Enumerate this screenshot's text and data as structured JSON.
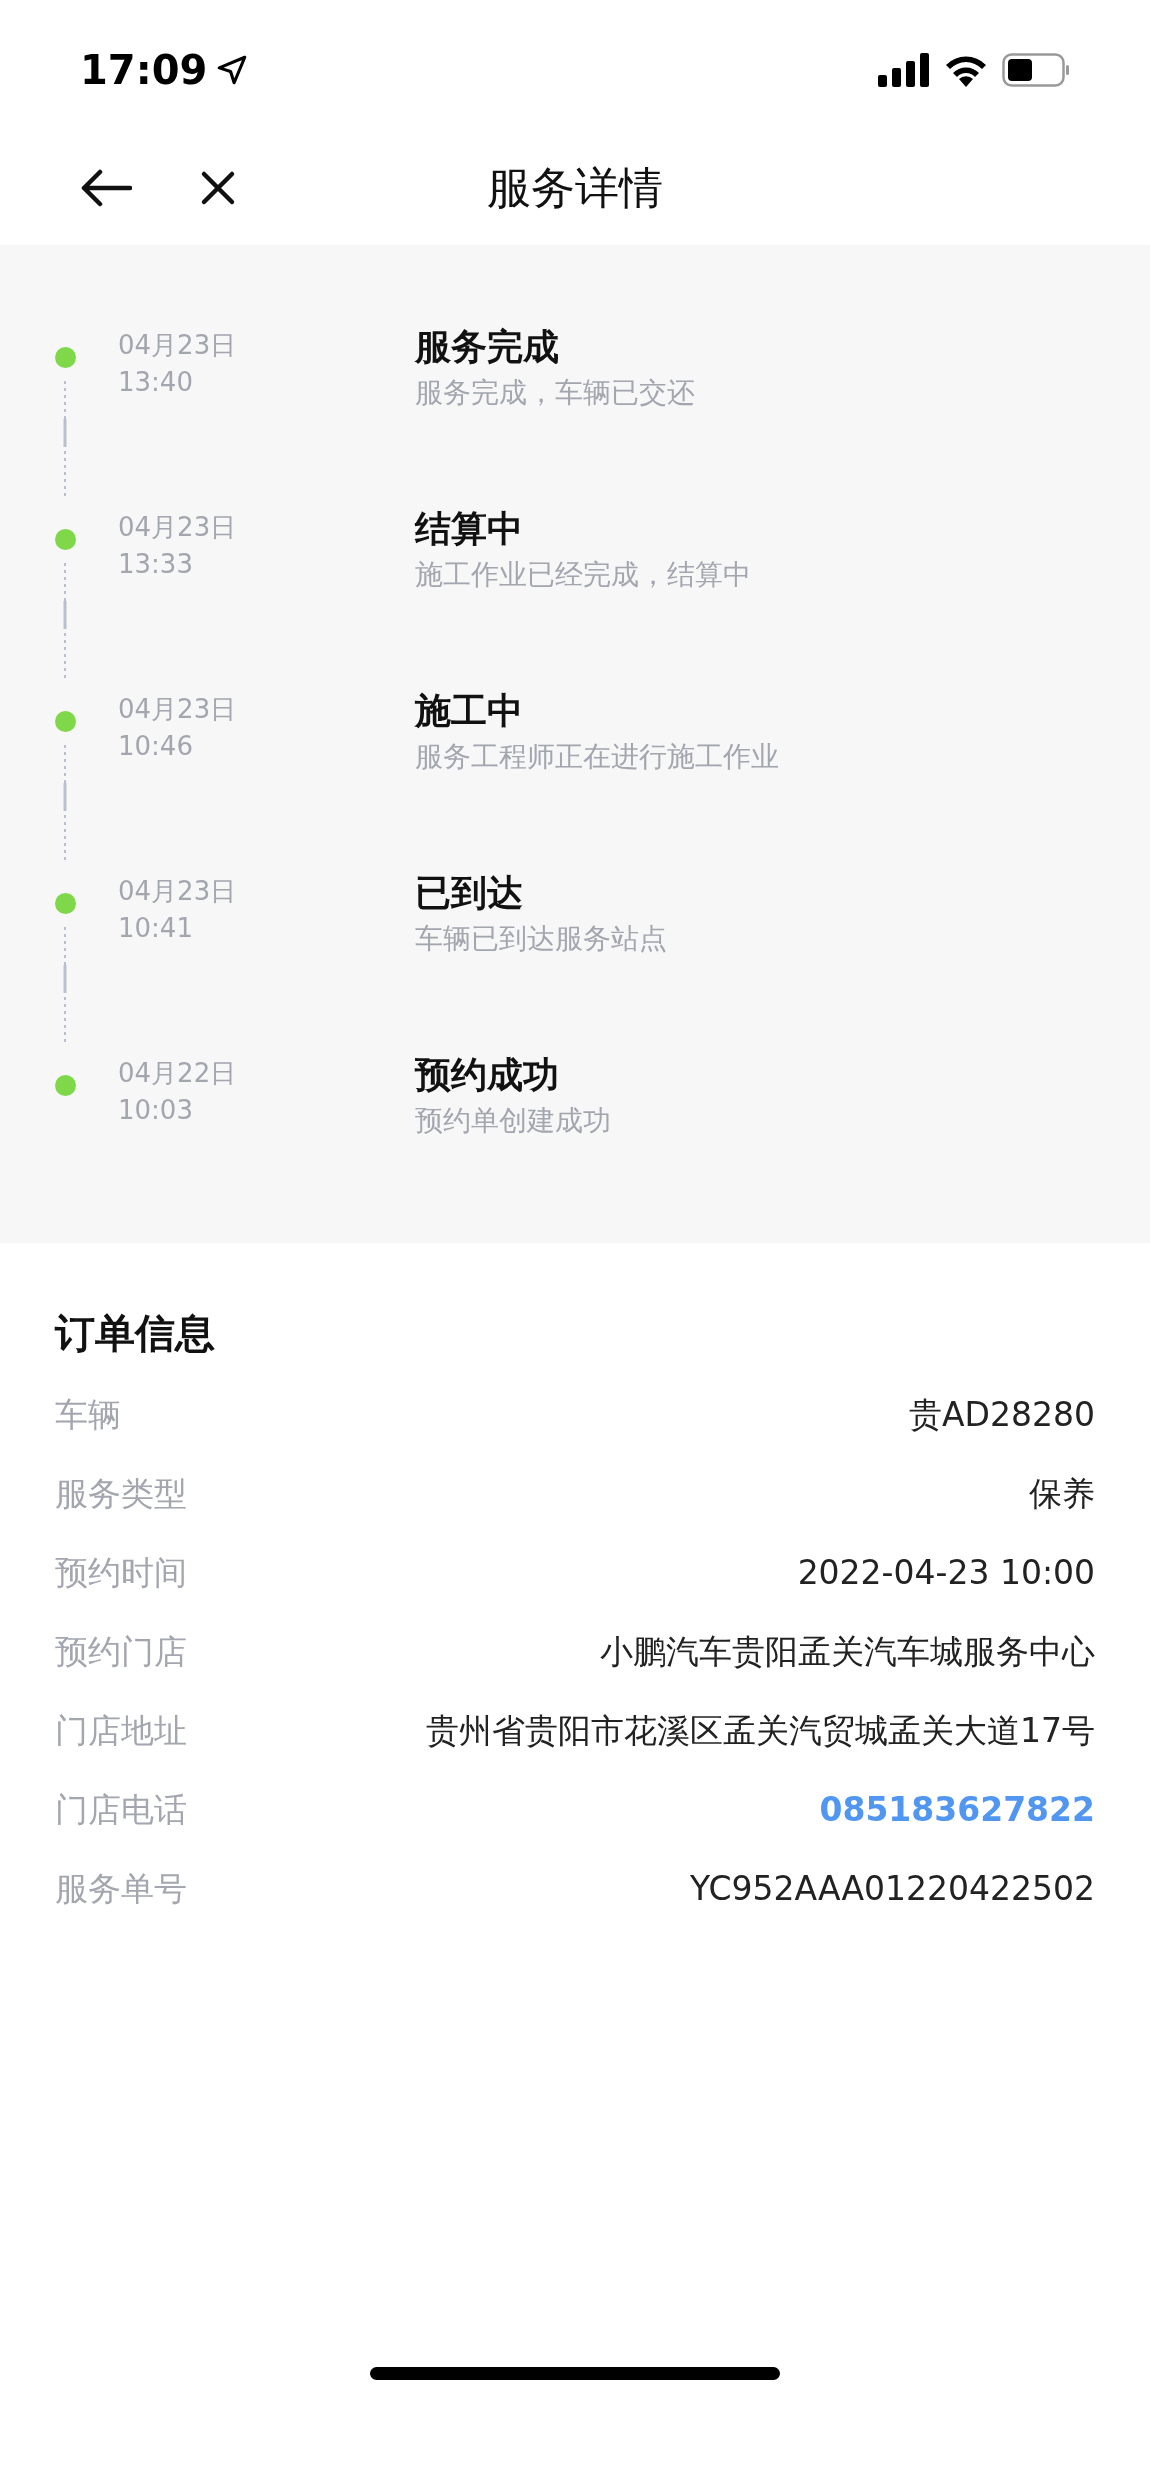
{
  "status_bar": {
    "time": "17:09"
  },
  "nav": {
    "title": "服务详情"
  },
  "timeline": [
    {
      "date": "04月23日",
      "time": "13:40",
      "title": "服务完成",
      "desc": "服务完成，车辆已交还",
      "color": "#7ed84a"
    },
    {
      "date": "04月23日",
      "time": "13:33",
      "title": "结算中",
      "desc": "施工作业已经完成，结算中",
      "color": "#7ed84a"
    },
    {
      "date": "04月23日",
      "time": "10:46",
      "title": "施工中",
      "desc": "服务工程师正在进行施工作业",
      "color": "#7ed84a"
    },
    {
      "date": "04月23日",
      "time": "10:41",
      "title": "已到达",
      "desc": "车辆已到达服务站点",
      "color": "#7ed84a"
    },
    {
      "date": "04月22日",
      "time": "10:03",
      "title": "预约成功",
      "desc": "预约单创建成功",
      "color": "#7ed84a"
    }
  ],
  "order_info": {
    "title": "订单信息",
    "rows": [
      {
        "label": "车辆",
        "value": "贵AD28280",
        "kind": "text"
      },
      {
        "label": "服务类型",
        "value": "保养",
        "kind": "text"
      },
      {
        "label": "预约时间",
        "value": "2022-04-23 10:00",
        "kind": "text"
      },
      {
        "label": "预约门店",
        "value": "小鹏汽车贵阳孟关汽车城服务中心",
        "kind": "text"
      },
      {
        "label": "门店地址",
        "value": "贵州省贵阳市花溪区孟关汽贸城孟关大道17号",
        "kind": "text"
      },
      {
        "label": "门店电话",
        "value": "085183627822",
        "kind": "phone"
      },
      {
        "label": "服务单号",
        "value": "YC952AAA01220422502",
        "kind": "text"
      }
    ]
  }
}
